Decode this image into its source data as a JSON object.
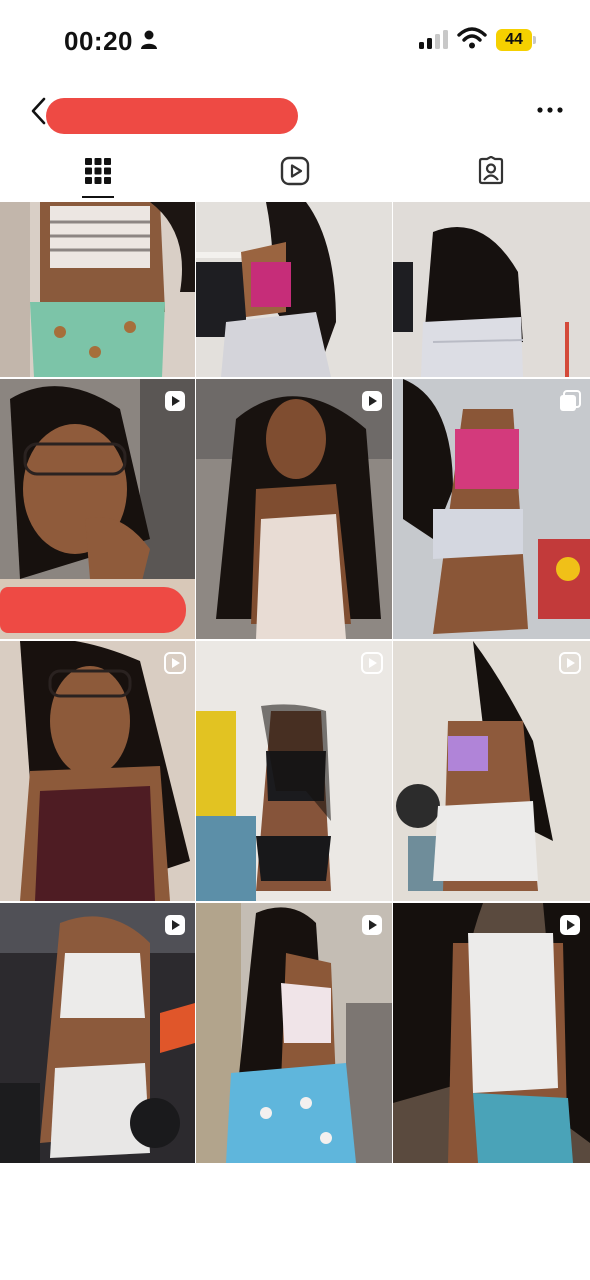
{
  "status_bar": {
    "time": "00:20",
    "battery": "44",
    "icons": [
      "person-icon",
      "cellular-signal-icon",
      "wifi-icon",
      "battery-icon"
    ]
  },
  "header": {
    "username": "",
    "back_icon": "chevron-left-icon",
    "more_icon": "more-horizontal-icon"
  },
  "tabs": [
    {
      "name": "grid",
      "icon": "grid-icon",
      "active": true
    },
    {
      "name": "reels",
      "icon": "reels-icon",
      "active": false
    },
    {
      "name": "tagged",
      "icon": "tagged-person-icon",
      "active": false
    }
  ],
  "posts": [
    {
      "type": "image",
      "badge": ""
    },
    {
      "type": "image",
      "badge": ""
    },
    {
      "type": "image",
      "badge": ""
    },
    {
      "type": "reel",
      "badge": "reel-icon"
    },
    {
      "type": "reel",
      "badge": "reel-icon"
    },
    {
      "type": "carousel",
      "badge": "carousel-icon"
    },
    {
      "type": "reel",
      "badge": "reel-icon"
    },
    {
      "type": "reel",
      "badge": "reel-icon"
    },
    {
      "type": "reel",
      "badge": "reel-icon"
    },
    {
      "type": "reel",
      "badge": "reel-icon"
    },
    {
      "type": "reel",
      "badge": "reel-icon"
    },
    {
      "type": "reel",
      "badge": "reel-icon"
    }
  ],
  "colors": {
    "redaction": "#ee4a44",
    "battery": "#f5d000",
    "tile_tones": [
      "#b9a99a",
      "#cfc9c2",
      "#d8d6d3",
      "#7d756c",
      "#a9a29b",
      "#c6c9cc",
      "#9d8f82",
      "#c9c4bd",
      "#cfc8be",
      "#6b6a6d",
      "#bdb3a7",
      "#5e4f44"
    ]
  }
}
